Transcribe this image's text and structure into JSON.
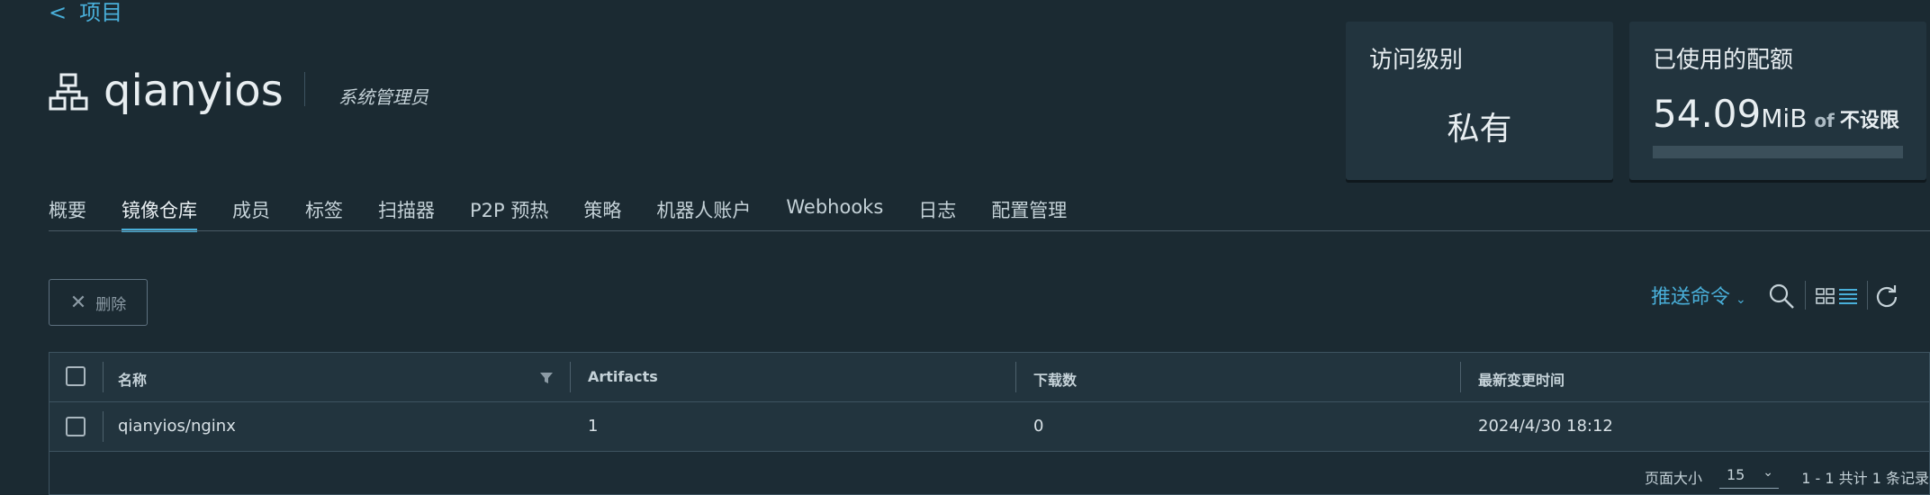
{
  "breadcrumb": {
    "chevron": "<",
    "label": "项目"
  },
  "project": {
    "icon": "project-network-icon",
    "name": "qianyios",
    "role": "系统管理员"
  },
  "cards": {
    "access": {
      "label": "访问级别",
      "value": "私有"
    },
    "quota": {
      "label": "已使用的配额",
      "used_number": "54.09",
      "used_unit": "MiB",
      "of": "of",
      "limit": "不设限"
    }
  },
  "tabs": [
    {
      "label": "概要",
      "active": false
    },
    {
      "label": "镜像仓库",
      "active": true
    },
    {
      "label": "成员",
      "active": false
    },
    {
      "label": "标签",
      "active": false
    },
    {
      "label": "扫描器",
      "active": false
    },
    {
      "label": "P2P 预热",
      "active": false
    },
    {
      "label": "策略",
      "active": false
    },
    {
      "label": "机器人账户",
      "active": false
    },
    {
      "label": "Webhooks",
      "active": false
    },
    {
      "label": "日志",
      "active": false
    },
    {
      "label": "配置管理",
      "active": false
    }
  ],
  "toolbar": {
    "delete_label": "删除",
    "push_command_label": "推送命令",
    "icons": [
      "search-icon",
      "card-view-icon",
      "list-view-icon",
      "refresh-icon"
    ]
  },
  "table": {
    "columns": [
      "名称",
      "Artifacts",
      "下载数",
      "最新变更时间"
    ],
    "rows": [
      {
        "name": "qianyios/nginx",
        "artifacts": "1",
        "downloads": "0",
        "updated": "2024/4/30 18:12"
      }
    ],
    "footer": {
      "page_size_label": "页面大小",
      "page_size": "15",
      "count_text": "1 - 1 共计 1 条记录"
    }
  },
  "colors": {
    "background": "#1b2a32",
    "card": "#22343e",
    "accent": "#49afd9",
    "text": "#e8eef1"
  }
}
